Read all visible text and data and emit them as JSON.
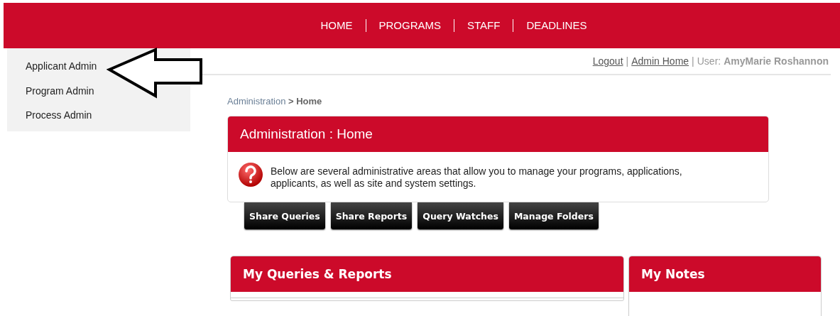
{
  "top_nav": {
    "items": [
      "HOME",
      "PROGRAMS",
      "STAFF",
      "DEADLINES"
    ]
  },
  "sidebar": {
    "items": [
      "Applicant Admin",
      "Program Admin",
      "Process Admin"
    ]
  },
  "user_bar": {
    "links": [
      "Logout",
      "Admin Home"
    ],
    "separator": "|",
    "user_label": "User:",
    "user_name": "AmyMarie Roshannon"
  },
  "breadcrumb": {
    "parent": "Administration",
    "separator": ">",
    "current": "Home"
  },
  "admin_panel": {
    "title": "Administration : Home",
    "message": "Below are several administrative areas that allow you to manage your programs, applications, applicants, as well as site and system settings."
  },
  "buttons": [
    "Share Queries",
    "Share Reports",
    "Query Watches",
    "Manage Folders"
  ],
  "panels": [
    {
      "title": "My Queries & Reports"
    },
    {
      "title": "My Notes"
    }
  ]
}
